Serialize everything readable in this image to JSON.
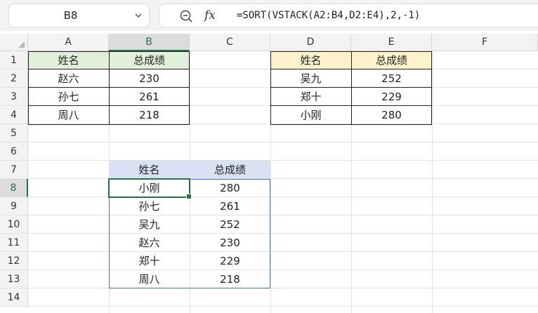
{
  "name_box": "B8",
  "formula": "=SORT(VSTACK(A2:B4,D2:E4),2,-1)",
  "fx_label": "fx",
  "columns": [
    "A",
    "B",
    "C",
    "D",
    "E",
    "F"
  ],
  "rows": [
    "1",
    "2",
    "3",
    "4",
    "5",
    "6",
    "7",
    "8",
    "9",
    "10",
    "11",
    "12",
    "13",
    "14"
  ],
  "table1": {
    "headers": [
      "姓名",
      "总成绩"
    ],
    "rows": [
      [
        "赵六",
        "230"
      ],
      [
        "孙七",
        "261"
      ],
      [
        "周八",
        "218"
      ]
    ]
  },
  "table2": {
    "headers": [
      "姓名",
      "总成绩"
    ],
    "rows": [
      [
        "吴九",
        "252"
      ],
      [
        "郑十",
        "229"
      ],
      [
        "小刚",
        "280"
      ]
    ]
  },
  "result": {
    "headers": [
      "姓名",
      "总成绩"
    ],
    "rows": [
      [
        "小刚",
        "280"
      ],
      [
        "孙七",
        "261"
      ],
      [
        "吴九",
        "252"
      ],
      [
        "赵六",
        "230"
      ],
      [
        "郑十",
        "229"
      ],
      [
        "周八",
        "218"
      ]
    ]
  },
  "colors": {
    "accent": "#217346",
    "header_green": "#e2efda",
    "header_yellow": "#fff2cc",
    "header_blue": "#d9e1f2",
    "result_border": "#4472c4"
  }
}
